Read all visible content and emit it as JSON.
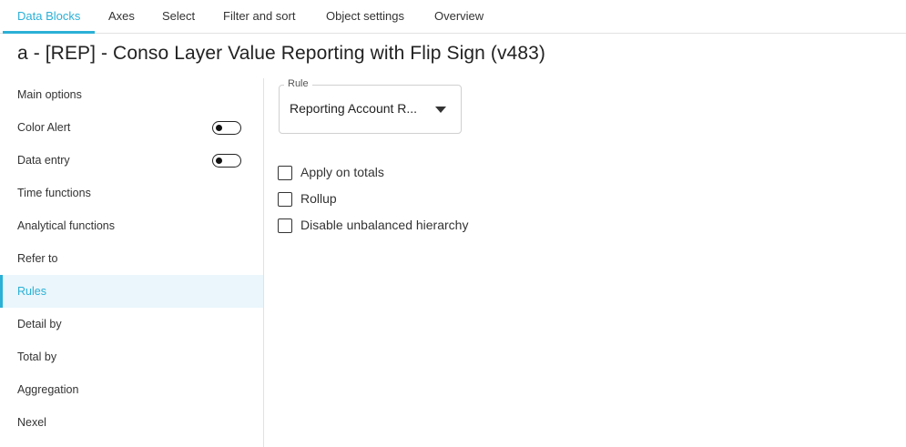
{
  "tabs": [
    {
      "label": "Data Blocks",
      "active": true
    },
    {
      "label": "Axes"
    },
    {
      "label": "Select"
    },
    {
      "label": "Filter and sort"
    },
    {
      "label": "Object settings"
    },
    {
      "label": "Overview"
    }
  ],
  "title": "a - [REP] - Conso Layer Value Reporting with Flip Sign (v483)",
  "sidebar": {
    "items": [
      {
        "label": "Main options"
      },
      {
        "label": "Color Alert",
        "toggle": "off"
      },
      {
        "label": "Data entry",
        "toggle": "off"
      },
      {
        "label": "Time functions"
      },
      {
        "label": "Analytical functions"
      },
      {
        "label": "Refer to"
      },
      {
        "label": "Rules",
        "active": true
      },
      {
        "label": "Detail by"
      },
      {
        "label": "Total by"
      },
      {
        "label": "Aggregation"
      },
      {
        "label": "Nexel"
      }
    ]
  },
  "rule": {
    "label": "Rule",
    "value": "Reporting Account R..."
  },
  "options": [
    {
      "label": "Apply on totals",
      "checked": false
    },
    {
      "label": "Rollup",
      "checked": false
    },
    {
      "label": "Disable unbalanced hierarchy",
      "checked": false
    }
  ],
  "colors": {
    "accent": "#2bb0d6",
    "active_bg": "#eaf6fb"
  }
}
